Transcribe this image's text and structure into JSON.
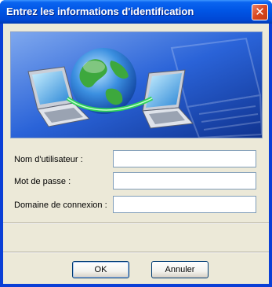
{
  "window": {
    "title": "Entrez les informations d'identification"
  },
  "form": {
    "username_label": "Nom d'utilisateur :",
    "password_label": "Mot de passe :",
    "domain_label": "Domaine de connexion :",
    "username_value": "",
    "password_value": "",
    "domain_value": ""
  },
  "buttons": {
    "ok": "OK",
    "cancel": "Annuler"
  },
  "icons": {
    "close": "close-icon",
    "banner": "network-globe-laptops-illustration"
  },
  "colors": {
    "titlebar": "#0055e5",
    "dialog_bg": "#ece9d8",
    "close": "#d9471e",
    "banner_bg": "#1c5ad8"
  }
}
